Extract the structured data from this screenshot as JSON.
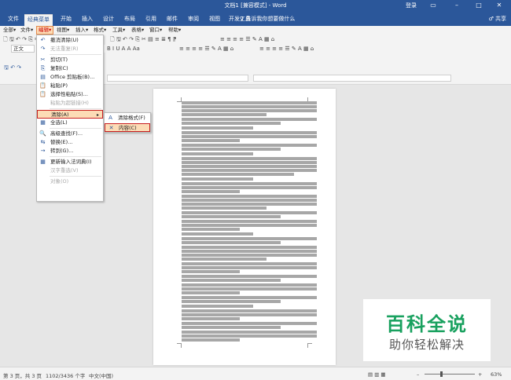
{
  "window": {
    "title": "文档1 [兼容模式] - Word",
    "login": "登录",
    "controls": [
      "▭",
      "–",
      "□",
      "✕"
    ]
  },
  "ribbon_tabs": [
    "文件",
    "经典菜单",
    "开始",
    "插入",
    "设计",
    "布局",
    "引用",
    "邮件",
    "审阅",
    "视图",
    "开发工具"
  ],
  "tell_me": "♀ 告诉我你想要做什么",
  "share": "♂ 共享",
  "menubar": [
    "全部▾",
    "文件▾",
    "编辑▾",
    "视图▾",
    "插入▾",
    "格式▾",
    "工具▾",
    "表格▾",
    "窗口▾",
    "帮助▾"
  ],
  "toolbar": {
    "style_box": "正文",
    "font_box": "宋体",
    "size_box": "五号",
    "format_buttons": "B  I  U  A  A  Aa",
    "row1_icons": "🗋 🖫 ↶ ↷ ⎘ ✂ ▤ ≡ ≣ ¶ ⁋",
    "row2_icons": "≡ ≡ ≡ ≡ ☰ ✎ A ▦ ⌂"
  },
  "quick_access": "🖫  ↶  ↷",
  "edit_menu": [
    {
      "label": "撤消清除(U)",
      "icon": "↶",
      "disabled": false,
      "icon_name": "undo-icon"
    },
    {
      "label": "无法重复(R)",
      "icon": "↷",
      "disabled": true,
      "icon_name": "redo-icon"
    },
    {
      "sep": true
    },
    {
      "label": "剪切(T)",
      "icon": "✂",
      "disabled": false,
      "icon_name": "cut-icon"
    },
    {
      "label": "复制(C)",
      "icon": "⎘",
      "disabled": false,
      "icon_name": "copy-icon"
    },
    {
      "label": "Office 剪贴板(B)...",
      "icon": "▤",
      "disabled": false,
      "icon_name": "clipboard-icon"
    },
    {
      "label": "粘贴(P)",
      "icon": "📋",
      "disabled": false,
      "icon_name": "paste-icon"
    },
    {
      "label": "选择性粘贴(S)...",
      "icon": "📋",
      "disabled": false,
      "icon_name": "paste-special-icon"
    },
    {
      "label": "粘贴为超链接(H)",
      "icon": "",
      "disabled": true,
      "icon_name": "paste-link-icon"
    },
    {
      "sep": true
    },
    {
      "label": "清除(A)",
      "icon": "",
      "disabled": false,
      "highlight": true,
      "submenu": true,
      "icon_name": "clear-icon"
    },
    {
      "label": "全选(L)",
      "icon": "▦",
      "disabled": false,
      "icon_name": "select-all-icon"
    },
    {
      "sep": true
    },
    {
      "label": "高级查找(F)...",
      "icon": "🔍",
      "disabled": false,
      "icon_name": "find-icon"
    },
    {
      "label": "替换(E)...",
      "icon": "⇆",
      "disabled": false,
      "icon_name": "replace-icon"
    },
    {
      "label": "转到(G)...",
      "icon": "→",
      "disabled": false,
      "icon_name": "goto-icon"
    },
    {
      "sep": true
    },
    {
      "label": "更新输入法词典(I)",
      "icon": "▦",
      "disabled": false,
      "icon_name": "ime-dictionary-icon"
    },
    {
      "label": "汉字重选(V)",
      "icon": "",
      "disabled": true,
      "icon_name": "reconvert-icon"
    },
    {
      "sep": true
    },
    {
      "label": "对象(O)",
      "icon": "",
      "disabled": true,
      "icon_name": "object-icon"
    }
  ],
  "clear_submenu": [
    {
      "label": "清除格式(F)",
      "icon": "A",
      "icon_name": "clear-format-icon",
      "highlight": false
    },
    {
      "label": "内容(C)",
      "icon": "✕",
      "icon_name": "clear-content-icon",
      "highlight": true
    }
  ],
  "logo": {
    "big": "百科全说",
    "small": "助你轻松解决"
  },
  "status": {
    "page": "第 3 页，共 3 页",
    "words": "1102/3436 个字",
    "lang": "中文(中国)",
    "zoom": "63%",
    "zoom_level": 0.63
  }
}
